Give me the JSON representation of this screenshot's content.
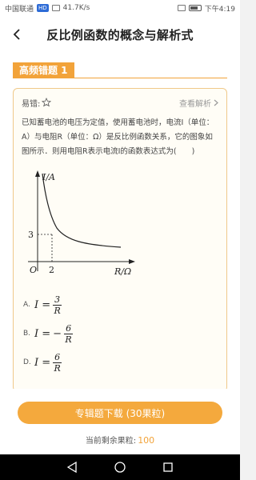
{
  "status_bar": {
    "carrier": "中国联通",
    "speed": "41.7K/s",
    "time": "下午4:19"
  },
  "header": {
    "title": "反比例函数的概念与解析式"
  },
  "section": {
    "tag": "高频错题 1"
  },
  "question": {
    "difficulty_label": "易错:",
    "analysis_link": "查看解析",
    "text": "已知蓄电池的电压为定值，使用蓄电池时，电流I（单位：A）与电阻R（单位：Ω）是反比例函数关系，它的图象如图所示．则用电阻R表示电流I的函数表达式为(　　)",
    "graph": {
      "y_axis_label": "I/A",
      "x_axis_label": "R/Ω",
      "origin_label": "O",
      "x_tick": "2",
      "y_tick": "3"
    },
    "options": [
      {
        "letter": "A.",
        "lhs": "I =",
        "sign": "",
        "num": "3",
        "den": "R"
      },
      {
        "letter": "B.",
        "lhs": "I =",
        "sign": "−",
        "num": "6",
        "den": "R"
      },
      {
        "letter": "D.",
        "lhs": "I =",
        "sign": "",
        "num": "6",
        "den": "R"
      }
    ]
  },
  "bottom": {
    "download_label": "专辑题下载 (30果粒)",
    "remaining_label": "当前剩余果粒:",
    "remaining_value": "100"
  },
  "colors": {
    "accent": "#f2a33a",
    "button": "#f4a93d",
    "card_border": "#f0c98a"
  }
}
